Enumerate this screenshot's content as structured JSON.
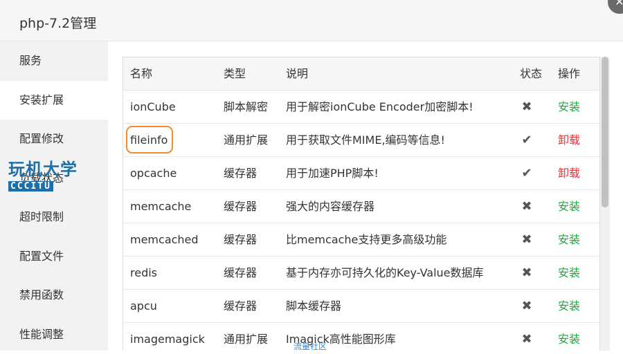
{
  "window": {
    "title": "php-7.2管理",
    "close_glyph": "✕"
  },
  "sidebar": {
    "items": [
      {
        "label": "服务"
      },
      {
        "label": "安装扩展"
      },
      {
        "label": "配置修改"
      },
      {
        "label": "负载状态"
      },
      {
        "label": "超时限制"
      },
      {
        "label": "配置文件"
      },
      {
        "label": "禁用函数"
      },
      {
        "label": "性能调整"
      }
    ],
    "active_index": 1
  },
  "watermark": {
    "cn": "玩机大学",
    "en": "CCCITU"
  },
  "table": {
    "headers": {
      "name": "名称",
      "type": "类型",
      "desc": "说明",
      "status": "状态",
      "op": "操作"
    },
    "rows": [
      {
        "name": "ionCube",
        "type": "脚本解密",
        "desc": "用于解密ionCube Encoder加密脚本!",
        "status": "✖",
        "status_icon": "cross-icon",
        "op": "安装",
        "op_kind": "install"
      },
      {
        "name": "fileinfo",
        "type": "通用扩展",
        "desc": "用于获取文件MIME,编码等信息!",
        "status": "✔",
        "status_icon": "check-icon",
        "op": "卸载",
        "op_kind": "uninstall"
      },
      {
        "name": "opcache",
        "type": "缓存器",
        "desc": "用于加速PHP脚本!",
        "status": "✔",
        "status_icon": "check-icon",
        "op": "卸载",
        "op_kind": "uninstall"
      },
      {
        "name": "memcache",
        "type": "缓存器",
        "desc": "强大的内容缓存器",
        "status": "✖",
        "status_icon": "cross-icon",
        "op": "安装",
        "op_kind": "install"
      },
      {
        "name": "memcached",
        "type": "缓存器",
        "desc": "比memcache支持更多高级功能",
        "status": "✖",
        "status_icon": "cross-icon",
        "op": "安装",
        "op_kind": "install"
      },
      {
        "name": "redis",
        "type": "缓存器",
        "desc": "基于内存亦可持久化的Key-Value数据库",
        "status": "✖",
        "status_icon": "cross-icon",
        "op": "安装",
        "op_kind": "install"
      },
      {
        "name": "apcu",
        "type": "缓存器",
        "desc": "脚本缓存器",
        "status": "✖",
        "status_icon": "cross-icon",
        "op": "安装",
        "op_kind": "install"
      },
      {
        "name": "imagemagick",
        "type": "通用扩展",
        "desc": "Imagick高性能图形库",
        "status": "✖",
        "status_icon": "cross-icon",
        "op": "安装",
        "op_kind": "install"
      }
    ],
    "highlighted_row": 1
  },
  "colors": {
    "install": "#20a53a",
    "uninstall": "#e0363b",
    "highlight": "#f28a2e"
  },
  "footer_watermark": "流量社区"
}
